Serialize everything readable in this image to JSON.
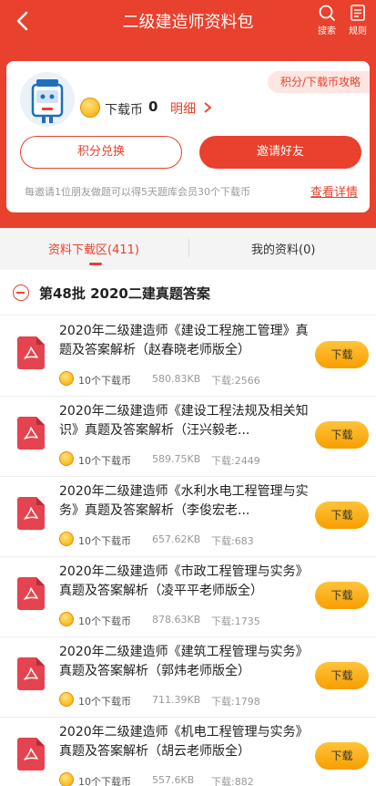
{
  "nav": {
    "title": "二级建造师资料包",
    "search_label": "搜索",
    "rules_label": "规则",
    "icons": {
      "back": "chevron-left-icon",
      "search": "search-icon",
      "rules": "document-icon"
    }
  },
  "account": {
    "strategy_tag": "积分/下载币攻略",
    "coin_label": "下载币",
    "coin_count": "0",
    "detail_label": "明细",
    "exchange_button": "积分兑换",
    "invite_button": "邀请好友",
    "invite_tip": "每邀请1位朋友做题可以得5天题库会员30个下载币",
    "view_detail": "查看详情"
  },
  "tabs": [
    {
      "label": "资料下载区(411)",
      "active": true
    },
    {
      "label": "我的资料(0)",
      "active": false
    }
  ],
  "batch": {
    "title": "第48批 2020二建真题答案"
  },
  "items": [
    {
      "title": "2020年二级建造师《建设工程施工管理》真题及答案解析（赵春晓老师版全）",
      "cost": "10个下载币",
      "size": "580.83KB",
      "downloads": "下载:2566",
      "button": "下载"
    },
    {
      "title": "2020年二级建造师《建设工程法规及相关知识》真题及答案解析（汪兴毅老...",
      "cost": "10个下载币",
      "size": "589.75KB",
      "downloads": "下载:2449",
      "button": "下载"
    },
    {
      "title": "2020年二级建造师《水利水电工程管理与实务》真题及答案解析（李俊宏老...",
      "cost": "10个下载币",
      "size": "657.62KB",
      "downloads": "下载:683",
      "button": "下载"
    },
    {
      "title": "2020年二级建造师《市政工程管理与实务》真题及答案解析（凌平平老师版全）",
      "cost": "10个下载币",
      "size": "878.63KB",
      "downloads": "下载:1735",
      "button": "下载"
    },
    {
      "title": "2020年二级建造师《建筑工程管理与实务》真题及答案解析（郭炜老师版全）",
      "cost": "10个下载币",
      "size": "711.39KB",
      "downloads": "下载:1798",
      "button": "下载"
    },
    {
      "title": "2020年二级建造师《机电工程管理与实务》真题及答案解析（胡云老师版全）",
      "cost": "10个下载币",
      "size": "557.6KB",
      "downloads": "下载:882",
      "button": "下载"
    }
  ],
  "colors": {
    "brand_red": "#e8412d",
    "download_orange": "#f79e00"
  }
}
